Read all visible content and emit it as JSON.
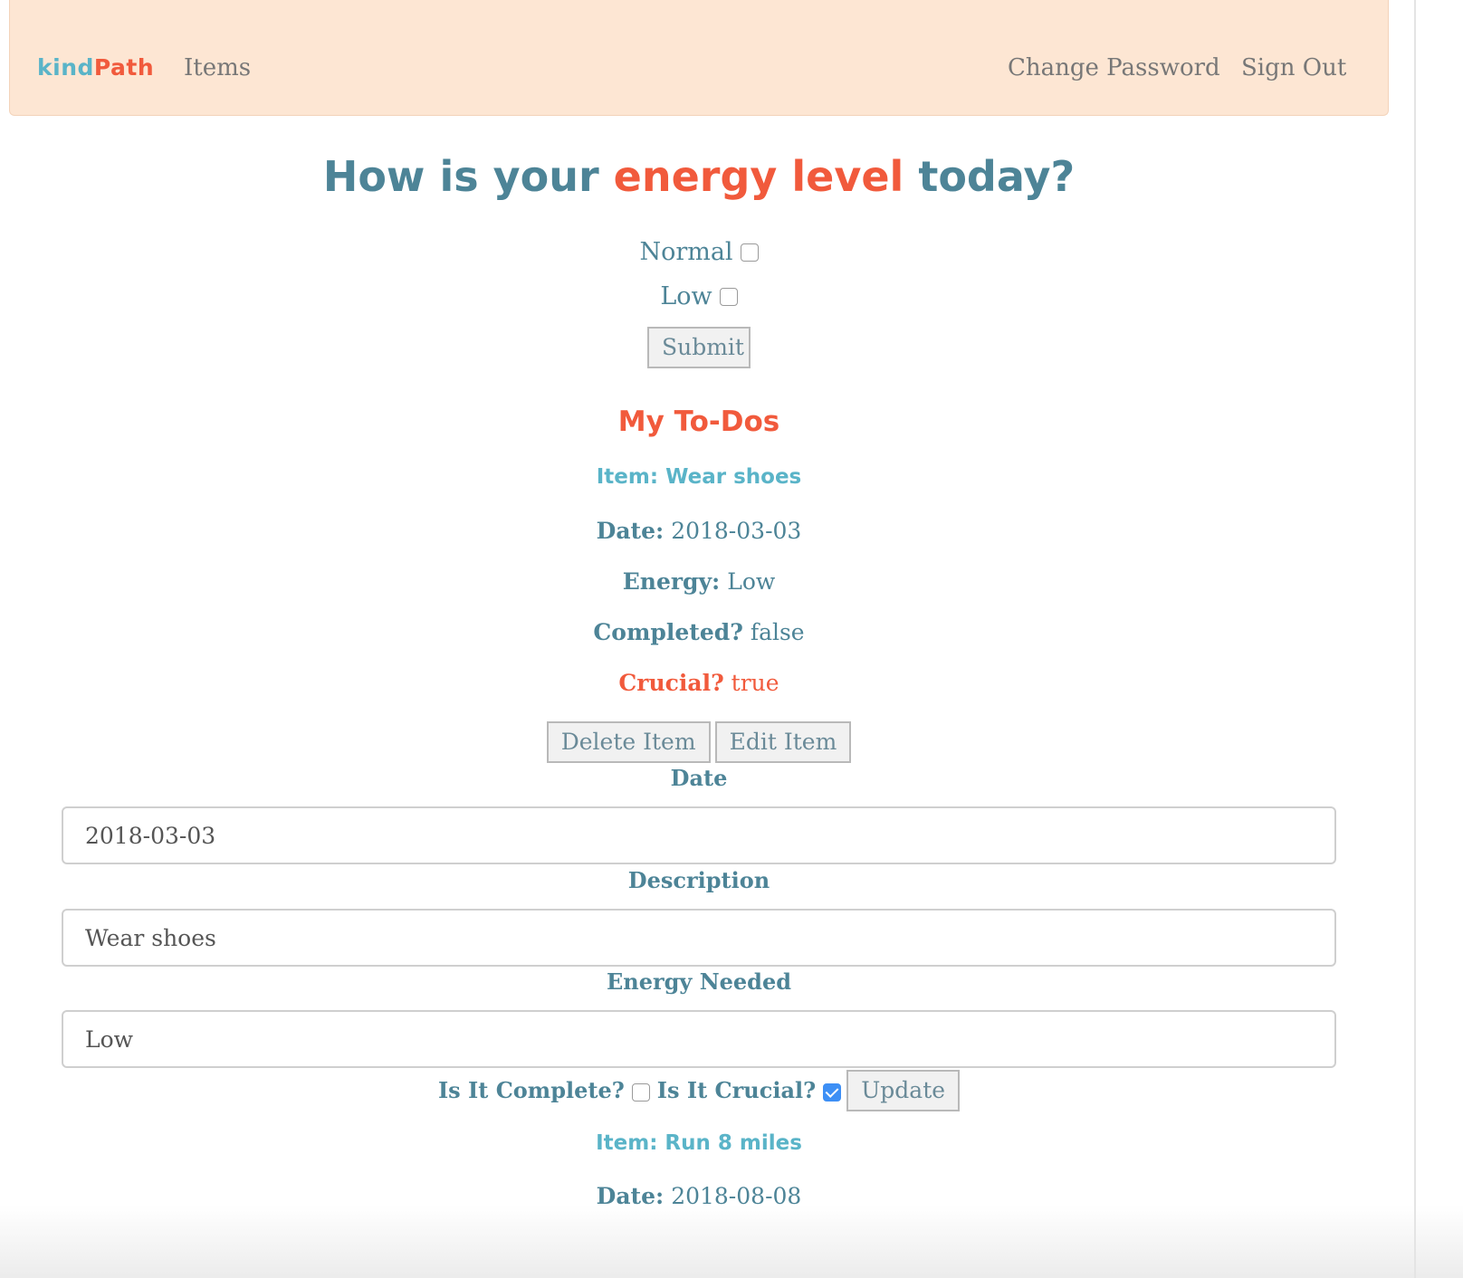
{
  "navbar": {
    "brand_part1": "kind",
    "brand_part2": "Path",
    "items_link": "Items",
    "change_password_link": "Change Password",
    "sign_out_link": "Sign Out"
  },
  "energy": {
    "heading_prefix": "How is your",
    "heading_accent": "energy level",
    "heading_suffix": "today?",
    "normal_label": "Normal",
    "low_label": "Low",
    "normal_checked": false,
    "low_checked": false,
    "submit_label": "Submit"
  },
  "todos": {
    "title": "My To-Dos",
    "items": [
      {
        "item_label": "Item: Wear shoes",
        "date_key": "Date:",
        "date_value": "2018-03-03",
        "energy_key": "Energy:",
        "energy_value": "Low",
        "completed_key": "Completed?",
        "completed_value": "false",
        "crucial_key": "Crucial?",
        "crucial_value": "true",
        "delete_label": "Delete Item",
        "edit_label": "Edit Item"
      },
      {
        "item_label": "Item: Run 8 miles",
        "date_key": "Date:",
        "date_value": "2018-08-08"
      }
    ]
  },
  "edit_form": {
    "date_label": "Date",
    "date_value": "2018-03-03",
    "description_label": "Description",
    "description_value": "Wear shoes",
    "energy_label": "Energy Needed",
    "energy_value": "Low",
    "complete_label": "Is It Complete?",
    "complete_checked": false,
    "crucial_label": "Is It Crucial?",
    "crucial_checked": true,
    "update_label": "Update"
  },
  "colors": {
    "navbar_bg": "#fde6d3",
    "primary_text": "#4d8497",
    "accent": "#f15a3c",
    "item_title": "#5ab4c8",
    "checkbox_checked": "#3d8ff5"
  }
}
